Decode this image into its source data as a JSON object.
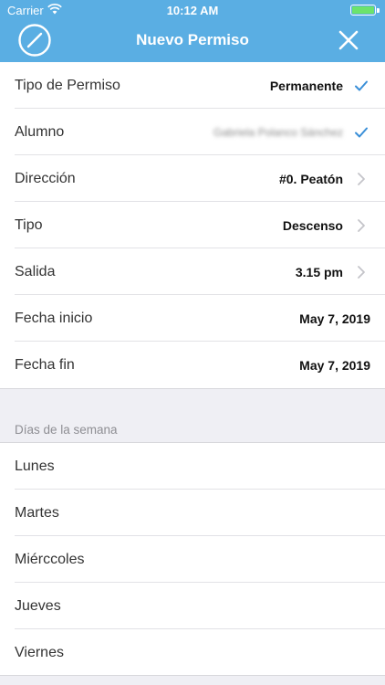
{
  "status_bar": {
    "carrier": "Carrier",
    "time": "10:12 AM"
  },
  "nav": {
    "title": "Nuevo Permiso",
    "left_icon": "compass-icon",
    "right_icon": "close-icon"
  },
  "form": {
    "rows": [
      {
        "label": "Tipo de Permiso",
        "value": "Permanente",
        "accessory": "checkmark"
      },
      {
        "label": "Alumno",
        "value": "Gabriela Polanco Sánchez",
        "accessory": "checkmark"
      },
      {
        "label": "Dirección",
        "value": "#0. Peatón",
        "accessory": "chevron"
      },
      {
        "label": "Tipo",
        "value": "Descenso",
        "accessory": "chevron"
      },
      {
        "label": "Salida",
        "value": "3.15 pm",
        "accessory": "chevron"
      },
      {
        "label": "Fecha inicio",
        "value": "May 7, 2019",
        "accessory": "none"
      },
      {
        "label": "Fecha fin",
        "value": "May 7, 2019",
        "accessory": "none"
      }
    ]
  },
  "days_section": {
    "header": "Días de la semana",
    "days": [
      "Lunes",
      "Martes",
      "Miérccoles",
      "Jueves",
      "Viernes"
    ]
  },
  "colors": {
    "header_bg": "#5aaee3",
    "checkmark": "#3a8fd8",
    "chevron": "#c4c4c9"
  }
}
